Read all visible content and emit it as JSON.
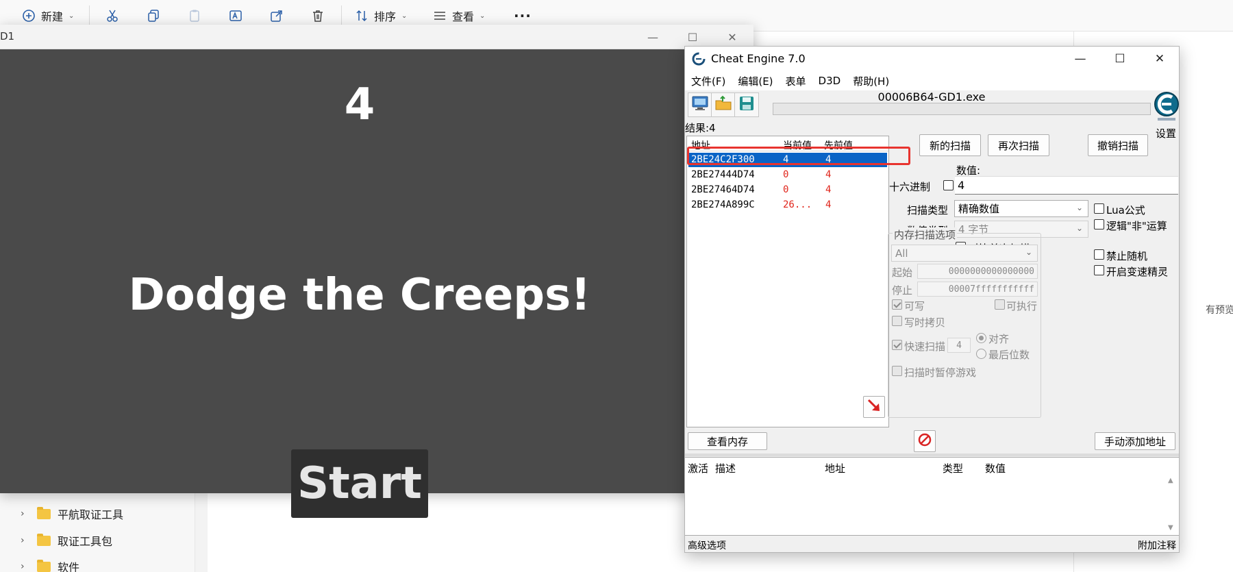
{
  "explorer": {
    "toolbar": {
      "new_label": "新建",
      "sort_label": "排序",
      "view_label": "查看",
      "more_label": "···"
    },
    "tree": [
      {
        "label": "平航取证工具"
      },
      {
        "label": "取证工具包"
      },
      {
        "label": "软件"
      }
    ],
    "preview_hint": "有预览。"
  },
  "game": {
    "window_title": "D1",
    "score": "4",
    "message": "Dodge the Creeps!",
    "start_label": "Start"
  },
  "cheat_engine": {
    "title": "Cheat Engine 7.0",
    "menu": [
      "文件(F)",
      "编辑(E)",
      "表单",
      "D3D",
      "帮助(H)"
    ],
    "process_name": "00006B64-GD1.exe",
    "settings_label": "设置",
    "results_label": "结果:4",
    "list_headers": {
      "address": "地址",
      "current": "当前值",
      "previous": "先前值"
    },
    "results": [
      {
        "address": "2BE24C2F300",
        "current": "4",
        "previous": "4",
        "selected": true
      },
      {
        "address": "2BE27444D74",
        "current": "0",
        "previous": "4",
        "selected": false
      },
      {
        "address": "2BE27464D74",
        "current": "0",
        "previous": "4",
        "selected": false
      },
      {
        "address": "2BE274A899C",
        "current": "26...",
        "previous": "4",
        "selected": false
      }
    ],
    "buttons": {
      "new_scan": "新的扫描",
      "next_scan": "再次扫描",
      "undo_scan": "撤销扫描",
      "memory_view": "查看内存",
      "add_address": "手动添加地址"
    },
    "value_label": "数值:",
    "hex_label": "十六进制",
    "value_input": "4",
    "scan_type_label": "扫描类型",
    "scan_type_value": "精确数值",
    "value_type_label": "数值类型",
    "value_type_value": "4 字节",
    "compare_first_label": "对比首次扫描",
    "lua_formula_label": "Lua公式",
    "not_operation_label": "逻辑\"非\"运算",
    "no_random_label": "禁止随机",
    "speedhack_label": "开启变速精灵",
    "mem_options": {
      "title": "内存扫描选项",
      "region": "All",
      "start_label": "起始",
      "start_value": "0000000000000000",
      "stop_label": "停止",
      "stop_value": "00007fffffffffff",
      "writable_label": "可写",
      "executable_label": "可执行",
      "copy_on_write_label": "写时拷贝",
      "fast_scan_label": "快速扫描",
      "fast_scan_value": "4",
      "align_label": "对齐",
      "last_digits_label": "最后位数",
      "pause_game_label": "扫描时暂停游戏"
    },
    "table_headers": {
      "active": "激活",
      "description": "描述",
      "address": "地址",
      "type": "类型",
      "value": "数值"
    },
    "advanced_options": "高级选项",
    "table_extras": "附加注释"
  }
}
